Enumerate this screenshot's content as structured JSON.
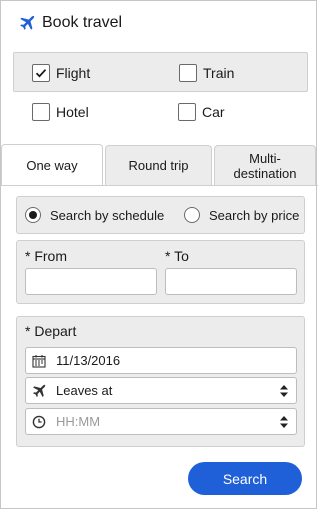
{
  "header": {
    "title": "Book travel",
    "icon": "airplane-icon",
    "accent": "#1f5fd8"
  },
  "travel_types": [
    {
      "label": "Flight",
      "checked": true
    },
    {
      "label": "Train",
      "checked": false
    },
    {
      "label": "Hotel",
      "checked": false
    },
    {
      "label": "Car",
      "checked": false
    }
  ],
  "tabs": [
    {
      "label": "One way",
      "active": true
    },
    {
      "label": "Round trip",
      "active": false
    },
    {
      "label": "Multi-destination",
      "active": false
    }
  ],
  "search_mode": {
    "options": [
      {
        "label": "Search by schedule",
        "selected": true
      },
      {
        "label": "Search by price",
        "selected": false
      }
    ]
  },
  "route": {
    "from_label": "* From",
    "to_label": "* To",
    "from_value": "",
    "to_value": ""
  },
  "depart": {
    "label": "* Depart",
    "date": "11/13/2016",
    "leaves_select": "Leaves at",
    "time_placeholder": "HH:MM"
  },
  "search_button": {
    "label": "Search",
    "color": "#1f5fd8"
  }
}
